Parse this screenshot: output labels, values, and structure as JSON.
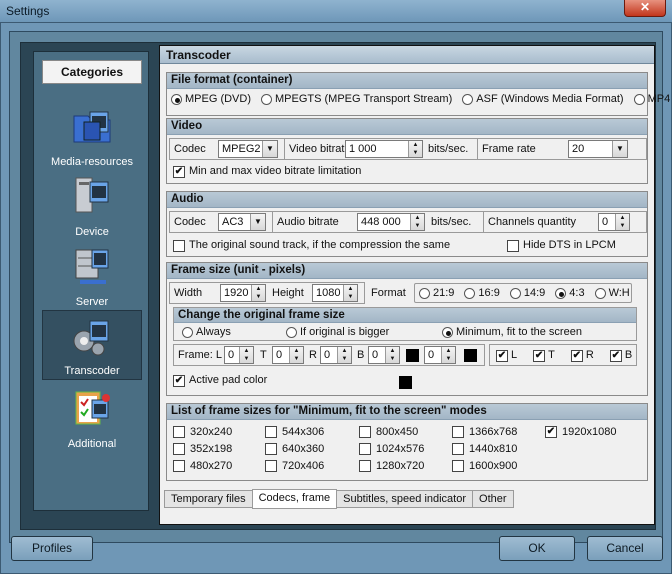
{
  "window": {
    "title": "Settings"
  },
  "categories": {
    "header": "Categories",
    "items": [
      {
        "label": "Media-resources"
      },
      {
        "label": "Device"
      },
      {
        "label": "Server"
      },
      {
        "label": "Transcoder"
      },
      {
        "label": "Additional"
      }
    ]
  },
  "panel": {
    "title": "Transcoder"
  },
  "file_format": {
    "title": "File format (container)",
    "options": [
      "MPEG (DVD)",
      "MPEGTS (MPEG Transport Stream)",
      "ASF (Windows Media Format)",
      "MP4"
    ],
    "selected": "MPEG (DVD)"
  },
  "video": {
    "title": "Video",
    "codec_label": "Codec",
    "codec_value": "MPEG2",
    "bitrate_label": "Video bitrat",
    "bitrate_value": "1 000",
    "bitrate_unit": "bits/sec.",
    "framerate_label": "Frame rate",
    "framerate_value": "20",
    "minmax_label": "Min and max video bitrate limitation",
    "minmax_checked": true
  },
  "audio": {
    "title": "Audio",
    "codec_label": "Codec",
    "codec_value": "AC3",
    "bitrate_label": "Audio bitrate",
    "bitrate_value": "448 000",
    "bitrate_unit": "bits/sec.",
    "channels_label": "Channels quantity",
    "channels_value": "0",
    "original_label": "The original sound track, if the compression the same",
    "hide_dts_label": "Hide DTS in LPCM"
  },
  "frame_size": {
    "title": "Frame size (unit - pixels)",
    "width_label": "Width",
    "width_value": "1920",
    "height_label": "Height",
    "height_value": "1080",
    "format_label": "Format",
    "formats": [
      "21:9",
      "16:9",
      "14:9",
      "4:3",
      "W:H"
    ],
    "format_selected": "4:3",
    "change": {
      "title": "Change the original frame size",
      "options": [
        "Always",
        "If original is bigger",
        "Minimum, fit to the screen"
      ],
      "selected": "Minimum, fit to the screen"
    },
    "frame_label": "Frame: L",
    "l_value": "0",
    "t_label": "T",
    "t_value": "0",
    "r_label": "R",
    "r_value": "0",
    "b_label": "B",
    "b_value": "0",
    "b2_value": "0",
    "checks": [
      {
        "label": "L"
      },
      {
        "label": "T"
      },
      {
        "label": "R"
      },
      {
        "label": "B"
      }
    ],
    "active_pad_label": "Active pad color"
  },
  "sizes": {
    "title": "List of frame sizes for \"Minimum, fit to the screen\" modes",
    "items": [
      "320x240",
      "544x306",
      "800x450",
      "1366x768",
      "1920x1080",
      "352x198",
      "640x360",
      "1024x576",
      "1440x810",
      "480x270",
      "720x406",
      "1280x720",
      "1600x900"
    ],
    "checked": "1920x1080"
  },
  "tabs": [
    "Temporary files",
    "Codecs, frame",
    "Subtitles, speed indicator",
    "Other"
  ],
  "active_tab": "Codecs, frame",
  "buttons": {
    "profiles": "Profiles",
    "ok": "OK",
    "cancel": "Cancel"
  },
  "icons": {
    "close": "close-icon",
    "check": "✔"
  }
}
